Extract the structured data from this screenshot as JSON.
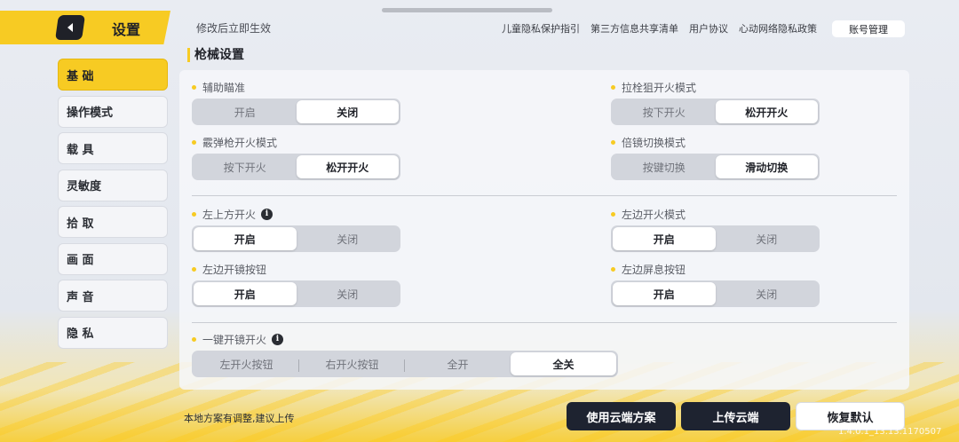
{
  "header": {
    "title": "设置",
    "notice": "修改后立即生效",
    "links": [
      "儿童隐私保护指引",
      "第三方信息共享清单",
      "用户协议",
      "心动网络隐私政策"
    ],
    "account_button": "账号管理"
  },
  "sidebar": {
    "items": [
      {
        "label": "基 础",
        "active": true
      },
      {
        "label": "操作模式",
        "active": false
      },
      {
        "label": "载 具",
        "active": false
      },
      {
        "label": "灵敏度",
        "active": false
      },
      {
        "label": "拾 取",
        "active": false
      },
      {
        "label": "画 面",
        "active": false
      },
      {
        "label": "声 音",
        "active": false
      },
      {
        "label": "隐 私",
        "active": false
      }
    ]
  },
  "main": {
    "section_title": "枪械设置",
    "settings": [
      {
        "label": "辅助瞄准",
        "options": [
          "开启",
          "关闭"
        ],
        "selected": 1
      },
      {
        "label": "拉栓狙开火模式",
        "options": [
          "按下开火",
          "松开开火"
        ],
        "selected": 1
      },
      {
        "label": "霰弹枪开火模式",
        "options": [
          "按下开火",
          "松开开火"
        ],
        "selected": 1
      },
      {
        "label": "倍镜切换模式",
        "options": [
          "按键切换",
          "滑动切换"
        ],
        "selected": 1
      },
      {
        "label": "左上方开火",
        "options": [
          "开启",
          "关闭"
        ],
        "selected": 0
      },
      {
        "label": "左边开火模式",
        "options": [
          "开启",
          "关闭"
        ],
        "selected": 0
      },
      {
        "label": "左边开镜按钮",
        "options": [
          "开启",
          "关闭"
        ],
        "selected": 0
      },
      {
        "label": "左边屏息按钮",
        "options": [
          "开启",
          "关闭"
        ],
        "selected": 0
      },
      {
        "label": "一键开镜开火",
        "options": [
          "左开火按钮",
          "右开火按钮",
          "全开",
          "全关"
        ],
        "selected": 3
      }
    ]
  },
  "footer": {
    "note": "本地方案有调整,建议上传",
    "use_cloud": "使用云端方案",
    "upload_cloud": "上传云端",
    "restore_default": "恢复默认",
    "version": "1.4.0.1_13.13.1170507"
  },
  "colors": {
    "accent": "#f7cb23",
    "dark_button": "#1e2330",
    "panel": "#f6f7fa"
  }
}
